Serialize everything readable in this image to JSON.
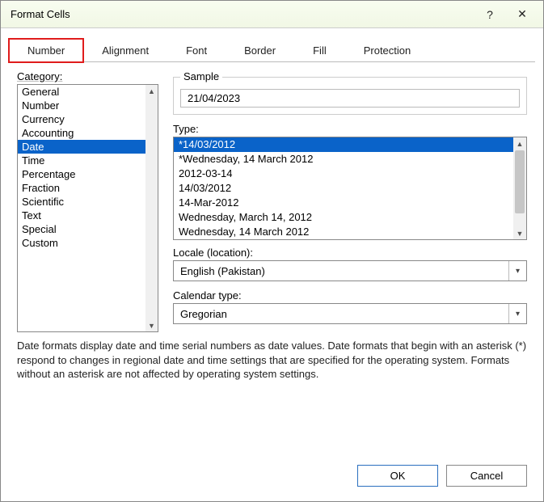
{
  "titlebar": {
    "title": "Format Cells",
    "help": "?",
    "close": "✕"
  },
  "tabs": {
    "items": [
      {
        "label": "Number"
      },
      {
        "label": "Alignment"
      },
      {
        "label": "Font"
      },
      {
        "label": "Border"
      },
      {
        "label": "Fill"
      },
      {
        "label": "Protection"
      }
    ]
  },
  "category": {
    "label": "Category:",
    "items": [
      "General",
      "Number",
      "Currency",
      "Accounting",
      "Date",
      "Time",
      "Percentage",
      "Fraction",
      "Scientific",
      "Text",
      "Special",
      "Custom"
    ],
    "selected": "Date"
  },
  "sample": {
    "label": "Sample",
    "value": "21/04/2023"
  },
  "type": {
    "label": "Type:",
    "items": [
      "*14/03/2012",
      "*Wednesday, 14 March 2012",
      "2012-03-14",
      "14/03/2012",
      "14-Mar-2012",
      "Wednesday, March 14, 2012",
      "Wednesday, 14 March 2012"
    ],
    "selected": "*14/03/2012"
  },
  "locale": {
    "label": "Locale (location):",
    "value": "English (Pakistan)"
  },
  "calendar": {
    "label": "Calendar type:",
    "value": "Gregorian"
  },
  "description": "Date formats display date and time serial numbers as date values.  Date formats that begin with an asterisk (*) respond to changes in regional date and time settings that are specified for the operating system. Formats without an asterisk are not affected by operating system settings.",
  "buttons": {
    "ok": "OK",
    "cancel": "Cancel"
  }
}
